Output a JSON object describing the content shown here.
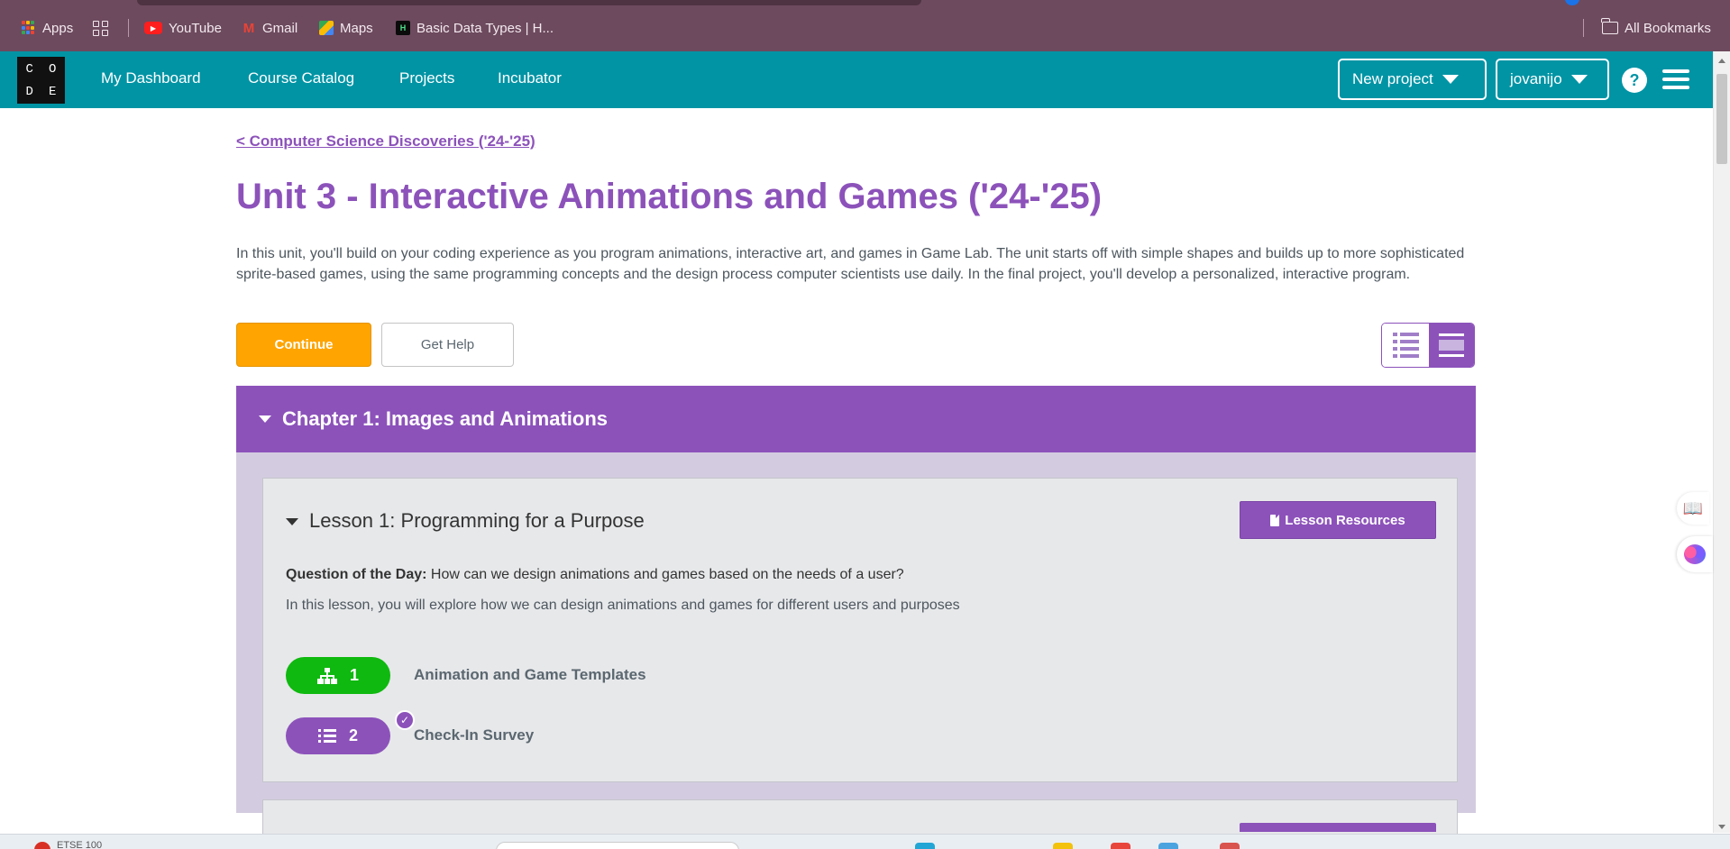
{
  "browser": {
    "bookmarks": [
      {
        "label": "Apps",
        "icon": "apps-icon"
      },
      {
        "label": "YouTube",
        "icon": "youtube-icon"
      },
      {
        "label": "Gmail",
        "icon": "gmail-icon"
      },
      {
        "label": "Maps",
        "icon": "maps-icon"
      },
      {
        "label": "Basic Data Types | H...",
        "icon": "hackerrank-icon"
      }
    ],
    "all_bookmarks": "All Bookmarks"
  },
  "header": {
    "logo_letters": [
      "C",
      "O",
      "D",
      "E"
    ],
    "nav": [
      "My Dashboard",
      "Course Catalog",
      "Projects",
      "Incubator"
    ],
    "new_project": "New project",
    "user": "jovanijo",
    "help_glyph": "?"
  },
  "page": {
    "breadcrumb": "< Computer Science Discoveries ('24-'25)",
    "title": "Unit 3 - Interactive Animations and Games ('24-'25)",
    "description": "In this unit, you'll build on your coding experience as you program animations, interactive art, and games in Game Lab. The unit starts off with simple shapes and builds up to more sophisticated sprite-based games, using the same programming concepts and the design process computer scientists use daily. In the final project, you'll develop a personalized, interactive program.",
    "continue": "Continue",
    "get_help": "Get Help"
  },
  "chapter": {
    "title": "Chapter 1: Images and Animations",
    "lesson": {
      "title": "Lesson 1: Programming for a Purpose",
      "resources": "Lesson Resources",
      "qotd_label": "Question of the Day:",
      "qotd": "How can we design animations and games based on the needs of a user?",
      "description": "In this lesson, you will explore how we can design animations and games for different users and purposes",
      "levels": [
        {
          "number": "1",
          "name": "Animation and Game Templates",
          "icon": "sitemap-icon",
          "color": "#0fb90f",
          "completed": false
        },
        {
          "number": "2",
          "name": "Check-In Survey",
          "icon": "list-icon",
          "color": "#8c52ba",
          "completed": true
        }
      ]
    }
  },
  "colors": {
    "brand_teal": "#0094a5",
    "purple": "#8c52ba",
    "continue_orange": "#ffa400",
    "bookmarks_bg": "#6d4a5e"
  },
  "taskbar": {
    "stock_text": "ETSE 100"
  }
}
